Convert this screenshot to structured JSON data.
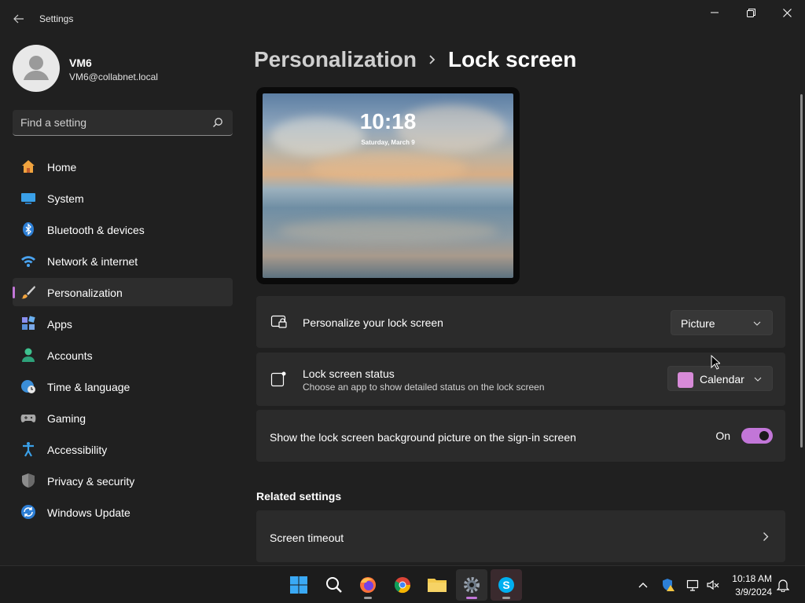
{
  "window": {
    "title": "Settings"
  },
  "user": {
    "name": "VM6",
    "email": "VM6@collabnet.local"
  },
  "search": {
    "placeholder": "Find a setting"
  },
  "sidebar": {
    "items": [
      {
        "label": "Home",
        "icon": "home-icon"
      },
      {
        "label": "System",
        "icon": "system-icon"
      },
      {
        "label": "Bluetooth & devices",
        "icon": "bluetooth-icon"
      },
      {
        "label": "Network & internet",
        "icon": "wifi-icon"
      },
      {
        "label": "Personalization",
        "icon": "brush-icon",
        "active": true
      },
      {
        "label": "Apps",
        "icon": "apps-icon"
      },
      {
        "label": "Accounts",
        "icon": "accounts-icon"
      },
      {
        "label": "Time & language",
        "icon": "globe-clock-icon"
      },
      {
        "label": "Gaming",
        "icon": "gamepad-icon"
      },
      {
        "label": "Accessibility",
        "icon": "accessibility-icon"
      },
      {
        "label": "Privacy & security",
        "icon": "shield-icon"
      },
      {
        "label": "Windows Update",
        "icon": "update-icon"
      }
    ]
  },
  "breadcrumb": {
    "parent": "Personalization",
    "current": "Lock screen"
  },
  "preview": {
    "time": "10:18",
    "date": "Saturday, March 9"
  },
  "settings": {
    "personalize": {
      "title": "Personalize your lock screen",
      "value": "Picture"
    },
    "status": {
      "title": "Lock screen status",
      "subtitle": "Choose an app to show detailed status on the lock screen",
      "value": "Calendar"
    },
    "signin_background": {
      "title": "Show the lock screen background picture on the sign-in screen",
      "state": "On",
      "enabled": true
    }
  },
  "related": {
    "heading": "Related settings",
    "items": [
      {
        "label": "Screen timeout"
      }
    ]
  },
  "taskbar": {
    "apps": [
      "start-icon",
      "search-icon",
      "firefox-icon",
      "chrome-icon",
      "file-explorer-icon",
      "settings-icon",
      "skype-icon"
    ],
    "time": "10:18 AM",
    "date": "3/9/2024"
  },
  "colors": {
    "accent": "#c276d8",
    "background": "#202020",
    "card": "#2b2b2b"
  }
}
